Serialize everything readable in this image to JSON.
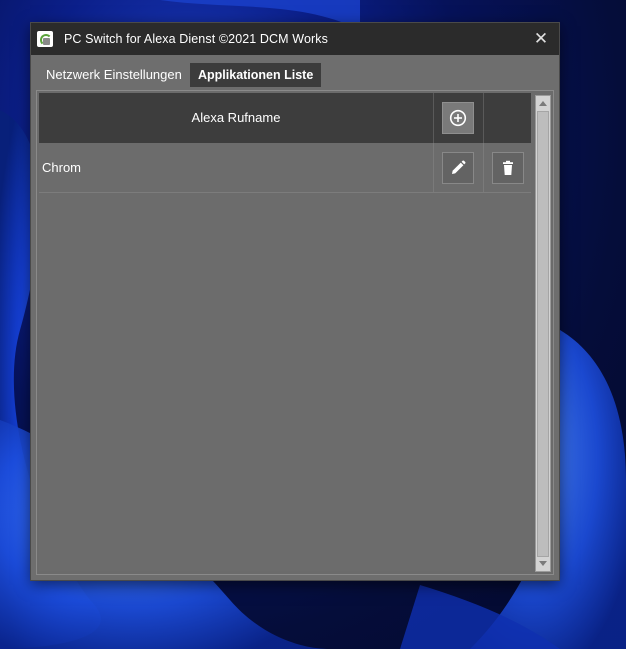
{
  "window": {
    "title": "PC Switch for Alexa Dienst ©2021 DCM Works",
    "close_glyph": "✕",
    "app_icon": "app-logo-icon"
  },
  "tabs": [
    {
      "label": "Netzwerk Einstellungen",
      "active": false
    },
    {
      "label": "Applikationen Liste",
      "active": true
    }
  ],
  "table": {
    "header": {
      "name_column": "Alexa Rufname",
      "add_icon": "plus-circle-icon"
    },
    "rows": [
      {
        "name": "Chrom",
        "edit_icon": "pencil-icon",
        "delete_icon": "trash-icon"
      }
    ]
  },
  "colors": {
    "titlebar": "#2b2b2b",
    "window_bg": "#6e6e6e",
    "header_bg": "#3d3d3d",
    "active_tab": "#3c3c3c",
    "text": "#ffffff"
  }
}
